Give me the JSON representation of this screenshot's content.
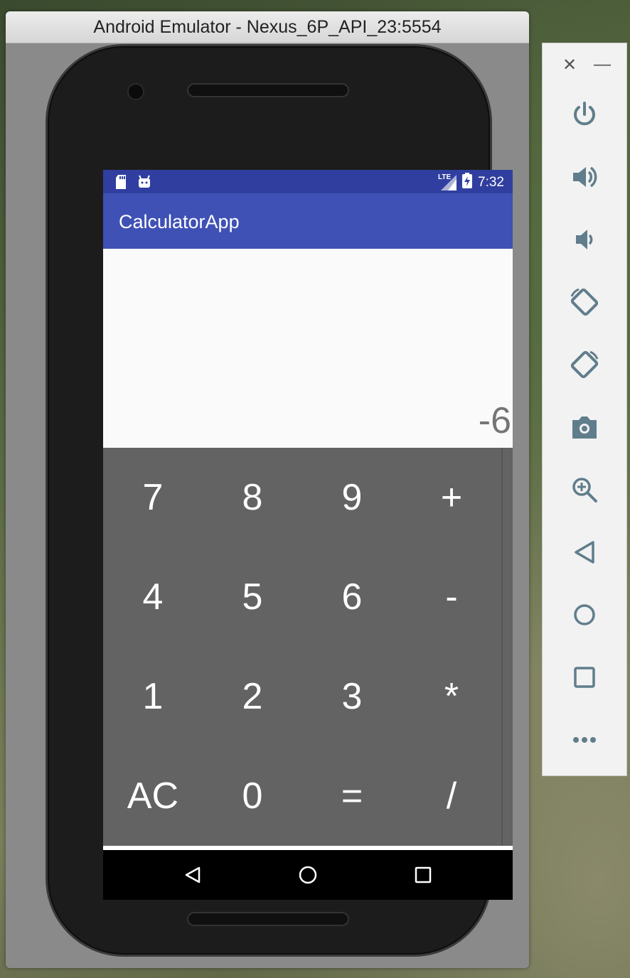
{
  "window": {
    "title": "Android Emulator - Nexus_6P_API_23:5554"
  },
  "status_bar": {
    "time": "7:32",
    "network": "LTE"
  },
  "app": {
    "title": "CalculatorApp"
  },
  "display": {
    "result": "-6"
  },
  "keypad": {
    "rows": [
      [
        "7",
        "8",
        "9",
        "+"
      ],
      [
        "4",
        "5",
        "6",
        "-"
      ],
      [
        "1",
        "2",
        "3",
        "*"
      ],
      [
        "AC",
        "0",
        "=",
        "/"
      ]
    ]
  },
  "nav": {
    "back": "back-icon",
    "home": "home-icon",
    "recents": "recents-icon"
  },
  "toolbar": {
    "buttons": [
      "power-icon",
      "volume-up-icon",
      "volume-down-icon",
      "rotate-left-icon",
      "rotate-right-icon",
      "camera-icon",
      "zoom-icon",
      "back-icon",
      "home-icon",
      "overview-icon",
      "more-icon"
    ]
  },
  "colors": {
    "status_bar": "#303f9f",
    "app_bar": "#3f51b5",
    "keypad": "#636363",
    "result_text": "#757575"
  }
}
